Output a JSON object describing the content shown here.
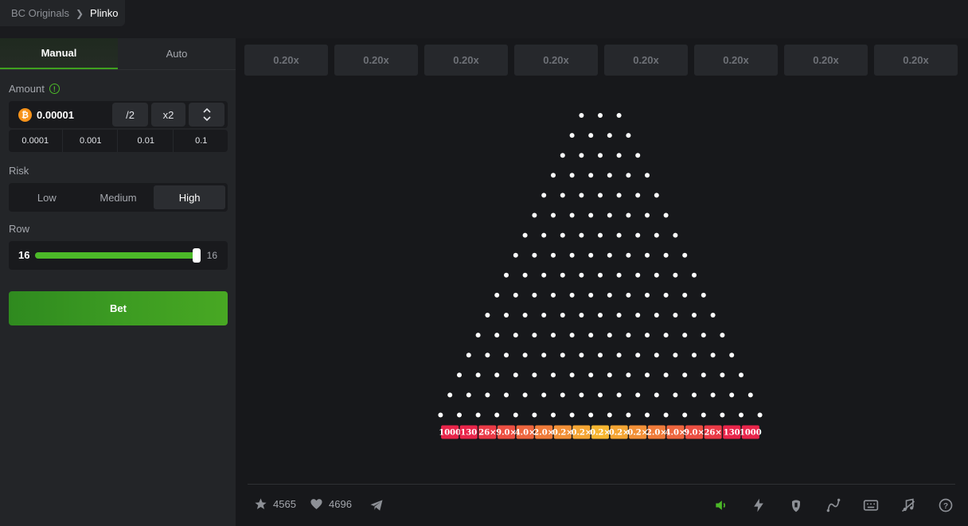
{
  "breadcrumb": {
    "parent": "BC Originals",
    "current": "Plinko"
  },
  "tabs": [
    "Manual",
    "Auto"
  ],
  "amount": {
    "label": "Amount",
    "value": "0.00001",
    "half_label": "/2",
    "double_label": "x2",
    "presets": [
      "0.0001",
      "0.001",
      "0.01",
      "0.1"
    ]
  },
  "risk": {
    "label": "Risk",
    "options": [
      "Low",
      "Medium",
      "High"
    ],
    "selected": "High"
  },
  "row": {
    "label": "Row",
    "value": "16",
    "max": "16",
    "fill_fraction": 1.0
  },
  "bet_label": "Bet",
  "history": [
    "0.20x",
    "0.20x",
    "0.20x",
    "0.20x",
    "0.20x",
    "0.20x",
    "0.20x",
    "0.20x"
  ],
  "board": {
    "rows": 16,
    "multipliers": [
      "1000",
      "130",
      "26×",
      "9.0×",
      "4.0×",
      "2.0×",
      "0.2×",
      "0.2×",
      "0.2×",
      "0.2×",
      "0.2×",
      "2.0×",
      "4.0×",
      "9.0×",
      "26×",
      "130",
      "1000"
    ],
    "bucket_colors": [
      "#e8254a",
      "#e8254a",
      "#ea3a46",
      "#ec4f42",
      "#ee663e",
      "#f07b3a",
      "#f29037",
      "#f4a533",
      "#f6b530",
      "#f4a533",
      "#f29037",
      "#f07b3a",
      "#ee663e",
      "#ec4f42",
      "#ea3a46",
      "#e8254a",
      "#e8254a"
    ],
    "peg_color": "#ffffff"
  },
  "footer": {
    "stars": "4565",
    "likes": "4696"
  },
  "accent_color": "#4cb928"
}
